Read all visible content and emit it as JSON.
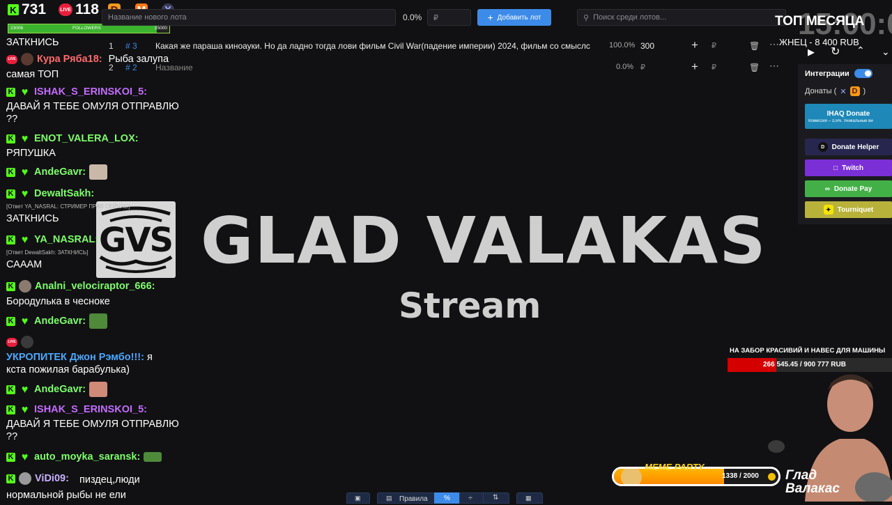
{
  "counters": {
    "kick_viewers": "731",
    "vk_viewers": "118",
    "kick_letter": "K",
    "live_label": "LIVE",
    "platform_d": "D",
    "platform_m": "M",
    "platform_x": "X"
  },
  "followers_bar": {
    "current": "23006",
    "label": "FOLLOWERS",
    "goal": "25000",
    "progress": 0.92
  },
  "chat": {
    "messages": [
      {
        "user": "",
        "text": "ЗАТКНИСЬ"
      },
      {
        "user": "Кура Ряба18:",
        "text": "Рыба залупа"
      },
      {
        "user": "",
        "text": "самая ТОП"
      },
      {
        "user": "ISHAK_S_ERINSKOI_5:",
        "text": "ДАВАЙ Я ТЕБЕ ОМУЛЯ ОТПРАВЛЮ ??"
      },
      {
        "user": "ENOT_VALERA_LOX:",
        "text": "РЯПУШКА"
      },
      {
        "user": "AndeGavr:",
        "text": ""
      },
      {
        "user": "DewaltSakh:",
        "reply": "[Ответ YA_NASRAL: СТРИМЕР ПРАВ СЕЙЧАС]",
        "text": "ЗАТКНИСЬ"
      },
      {
        "user": "YA_NASRAL:",
        "reply": "[Ответ DewaltSakh: ЗАТКНИСЬ]",
        "text": "СААAM"
      },
      {
        "user": "Analni_velociraptor_666:",
        "text": "Бородулька в чесноке"
      },
      {
        "user": "AndeGavr:",
        "text": ""
      },
      {
        "user": "УКРОПИТЕК Джон Рэмбо!!!:",
        "text": "я кста пожилая барабулька)"
      },
      {
        "user": "AndeGavr:",
        "text": ""
      },
      {
        "user": "ISHAK_S_ERINSKOI_5:",
        "text": "ДАВАЙ Я ТЕБЕ ОМУЛЯ ОТПРАВЛЮ ??"
      },
      {
        "user": "auto_moyka_saransk:",
        "text": ""
      },
      {
        "user": "ViDi09:",
        "text": "пиздец,люди нормальной рыбы не ели"
      }
    ]
  },
  "auction": {
    "new_lot_placeholder": "Название нового лота",
    "percent": "0.0%",
    "currency": "₽",
    "add_button": "Добавить лот",
    "search_placeholder": "Поиск среди лотов...",
    "lots": [
      {
        "index": "1",
        "tag": "# 3",
        "name": "Какая же параша киноауки. Но да ладно тогда лови фильм Civil War(падение империи) 2024, фильм со смыслс",
        "percent": "100.0%",
        "amount": "300"
      },
      {
        "index": "2",
        "tag": "# 2",
        "name": "Название",
        "percent": "0.0%",
        "amount": ""
      }
    ]
  },
  "top_month": {
    "title": "ТОП МЕСЯЦА",
    "entry": "ЖНЕЦ - 8 400 RUB",
    "timer": "15:00:0"
  },
  "integrations": {
    "label": "Интеграции",
    "donations_label": "Донаты (",
    "donations_close": ")",
    "buttons": [
      {
        "label": "IHAQ Donate",
        "sub": "Комиссия – 3,5%. Уникальные ви",
        "color": "#1e88b8"
      },
      {
        "label": "Donate Helper",
        "color": "#2a2a5a"
      },
      {
        "label": "Twitch",
        "color": "#7b2fd6"
      },
      {
        "label": "Donate Pay",
        "color": "#43b047"
      },
      {
        "label": "Tourniquet",
        "color": "#b9b23a"
      }
    ]
  },
  "stream": {
    "title": "GLAD VALAKAS",
    "subtitle": "Stream",
    "logo": "GVS"
  },
  "goal": {
    "title": "НА ЗАБОР КРАСИВИЙ И НАВЕС ДЛЯ МАШИНЫ",
    "value": "266 545.45 / 900 777 RUB",
    "progress": 0.296
  },
  "meme_party": {
    "title": "MEME PARTY",
    "value": "1338 / 2000",
    "progress": 0.669
  },
  "streamer_name": "Глад Валакас",
  "bottom_toolbar": {
    "rules": "Правила",
    "percent_icon": "%"
  }
}
